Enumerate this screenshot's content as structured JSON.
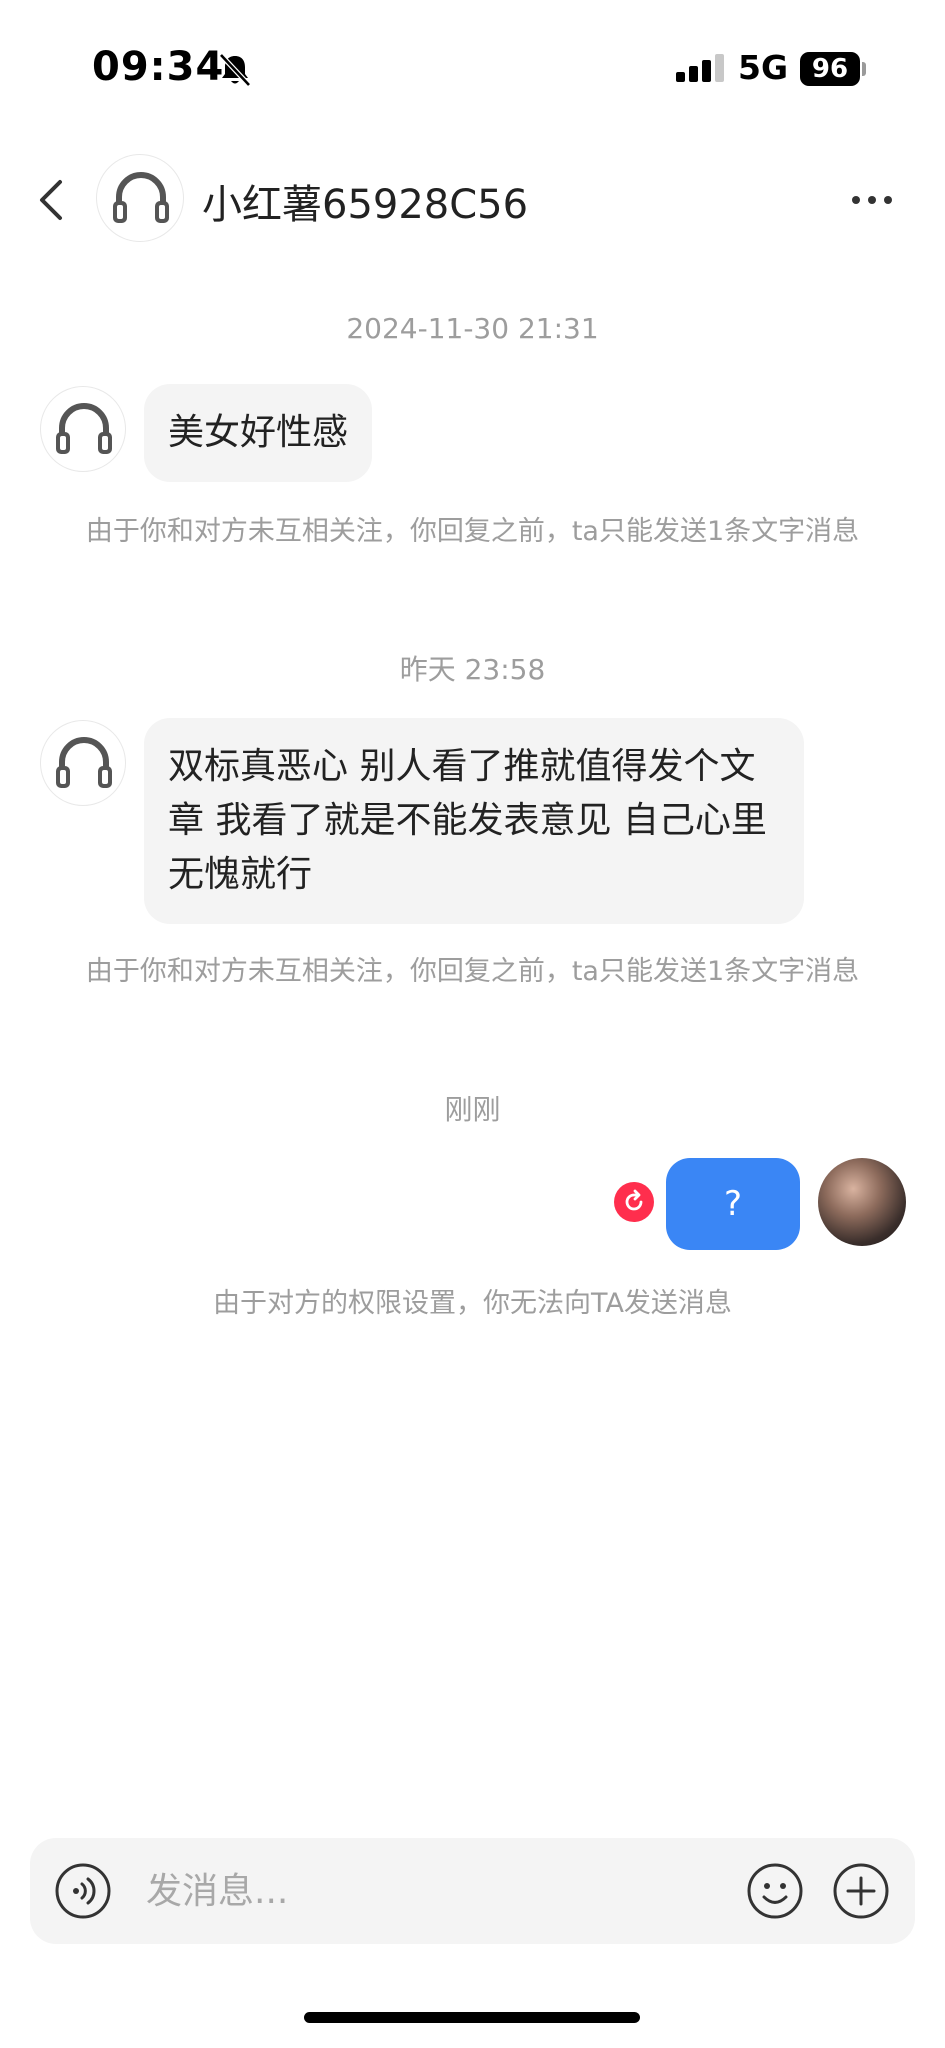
{
  "status_bar": {
    "time": "09:34",
    "network": "5G",
    "battery": "96"
  },
  "header": {
    "title": "小红薯65928C56"
  },
  "messages": [
    {
      "timestamp": "2024-11-30 21:31",
      "text": "美女好性感",
      "notice": "由于你和对方未互相关注，你回复之前，ta只能发送1条文字消息"
    },
    {
      "timestamp": "昨天 23:58",
      "text": "双标真恶心 别人看了推就值得发个文章 我看了就是不能发表意见 自己心里无愧就行",
      "notice": "由于你和对方未互相关注，你回复之前，ta只能发送1条文字消息"
    }
  ],
  "outgoing": {
    "timestamp": "刚刚",
    "text": "?",
    "notice": "由于对方的权限设置，你无法向TA发送消息"
  },
  "input": {
    "placeholder": "发消息..."
  },
  "colors": {
    "accent_blue": "#3a86f5",
    "recall_red": "#ff2e4d",
    "bubble_grey": "#f4f4f4",
    "meta_grey": "#9d9d9d"
  },
  "icons": [
    "back-arrow-icon",
    "headphones-avatar-icon",
    "more-dots-icon",
    "recall-icon",
    "voice-icon",
    "emoji-icon",
    "plus-icon",
    "bell-muted-icon",
    "signal-icon"
  ]
}
